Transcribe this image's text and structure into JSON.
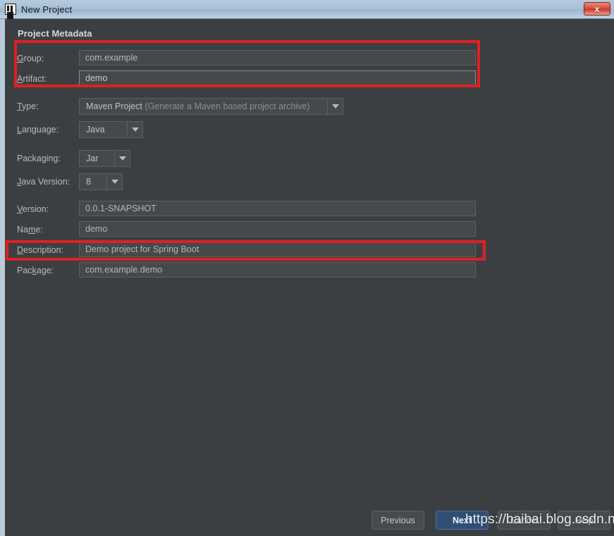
{
  "window": {
    "title": "New Project",
    "icon": "intellij-idea-icon",
    "close_label": "x",
    "titlebar_color": "#a9c0d6",
    "body_color": "#3c3f41"
  },
  "section": {
    "heading": "Project Metadata"
  },
  "form": {
    "fields": [
      {
        "name": "group",
        "label": "Group:",
        "mnemonic": "G",
        "value": "com.example",
        "type": "text",
        "focused": false
      },
      {
        "name": "artifact",
        "label": "Artifact:",
        "mnemonic": "A",
        "value": "demo",
        "type": "text",
        "focused": true
      },
      {
        "name": "type",
        "label": "Type:",
        "mnemonic": "T",
        "value": "Maven Project",
        "hint": "(Generate a Maven based project archive)",
        "type": "combo"
      },
      {
        "name": "language",
        "label": "Language:",
        "mnemonic": "L",
        "value": "Java",
        "type": "combo"
      },
      {
        "name": "packaging",
        "label": "Packaging:",
        "mnemonic": "g",
        "value": "Jar",
        "type": "combo"
      },
      {
        "name": "java-version",
        "label": "Java Version:",
        "mnemonic": "J",
        "value": "8",
        "type": "combo"
      },
      {
        "name": "version",
        "label": "Version:",
        "mnemonic": "V",
        "value": "0.0.1-SNAPSHOT",
        "type": "text",
        "focused": false
      },
      {
        "name": "project-name",
        "label": "Name:",
        "mnemonic": "m",
        "value": "demo",
        "type": "text",
        "focused": false
      },
      {
        "name": "description",
        "label": "Description:",
        "mnemonic": "D",
        "value": "Demo project for Spring Boot",
        "type": "text",
        "focused": false
      },
      {
        "name": "package",
        "label": "Package:",
        "mnemonic": "k",
        "value": "com.example.demo",
        "type": "text",
        "focused": false
      }
    ]
  },
  "annotations": {
    "color": "#e02020",
    "boxes": [
      {
        "name": "group-artifact-highlight",
        "targets": "group, artifact"
      },
      {
        "name": "description-highlight",
        "targets": "description"
      }
    ]
  },
  "buttons": {
    "previous": "Previous",
    "next": "Next",
    "cancel": "Cancel",
    "help": "Help"
  },
  "watermark": {
    "text": "https://baibai.blog.csdn.net"
  }
}
